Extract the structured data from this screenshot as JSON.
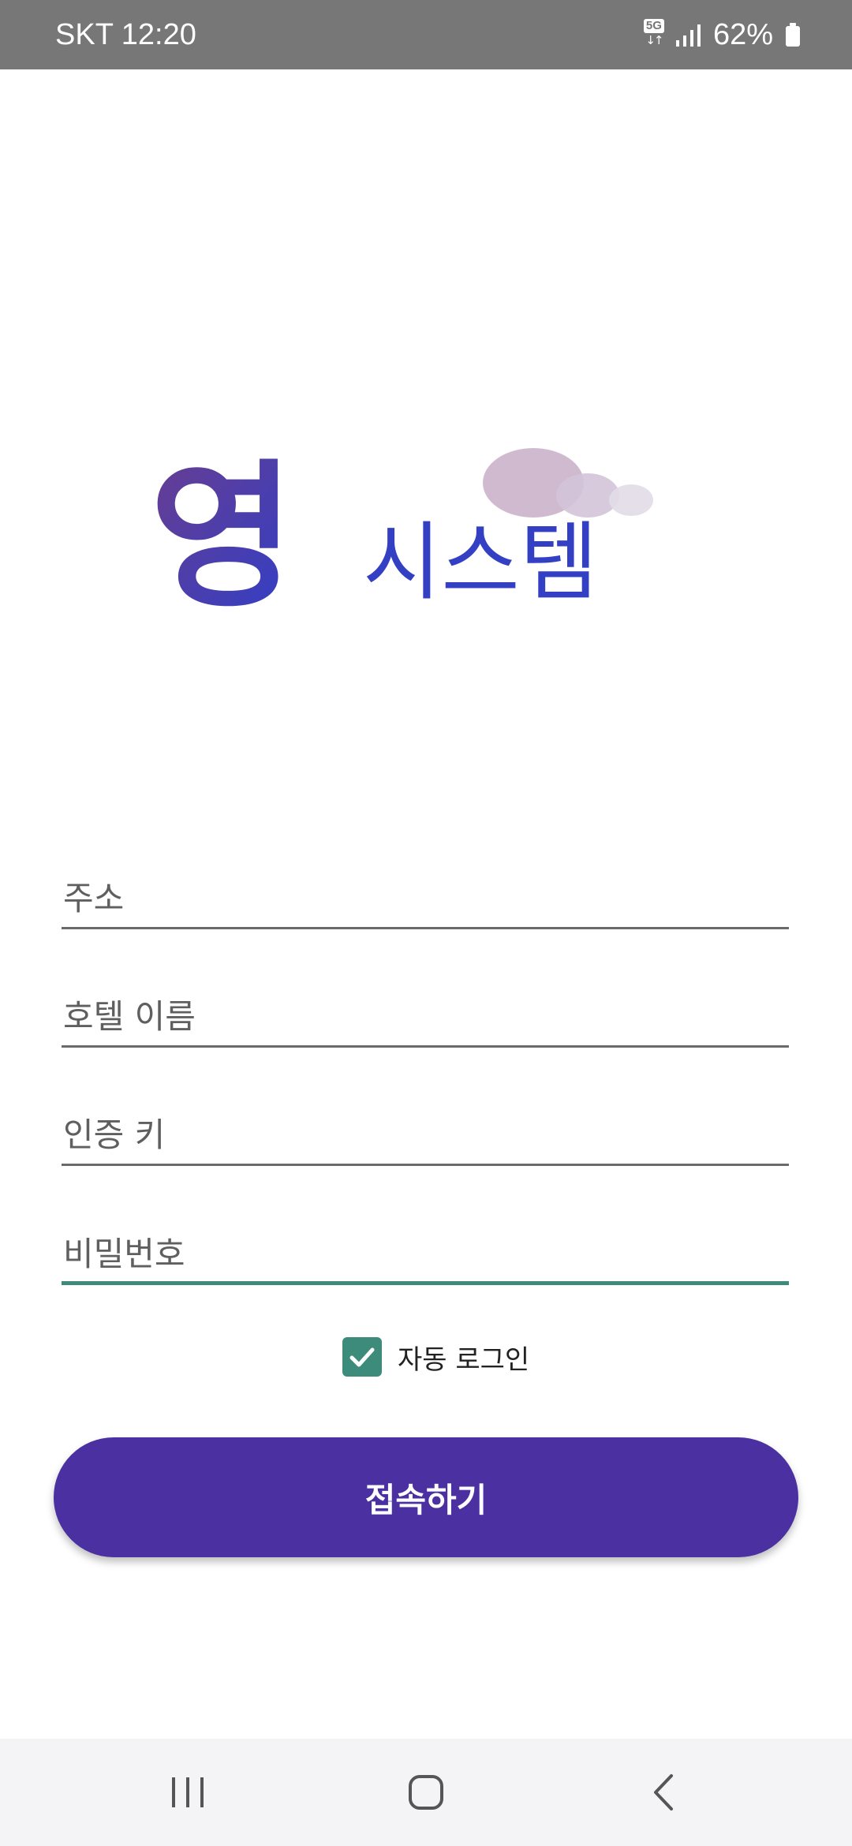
{
  "status_bar": {
    "carrier_time": "SKT 12:20",
    "network": "5G",
    "network_arrows": "↓↑",
    "battery": "62%",
    "icons": [
      "5g-icon",
      "signal-icon",
      "battery-icon"
    ]
  },
  "logo": {
    "text_main": "영",
    "text_sub": "시스템",
    "colors": {
      "gradient_start": "#6a3d8f",
      "gradient_end": "#2f3fc8",
      "bubble": "#cdb6cc"
    }
  },
  "form": {
    "address_label": "주소",
    "hotel_name_label": "호텔 이름",
    "auth_key_label": "인증 키",
    "password_label": "비밀번호",
    "auto_login_label": "자동 로그인",
    "auto_login_checked": true,
    "connect_label": "접속하기"
  },
  "colors": {
    "accent": "#3d8b7a",
    "button": "#4b30a2",
    "status_bar": "#777777"
  },
  "nav_bar": {
    "icons": [
      "recents-icon",
      "home-icon",
      "back-icon"
    ]
  }
}
